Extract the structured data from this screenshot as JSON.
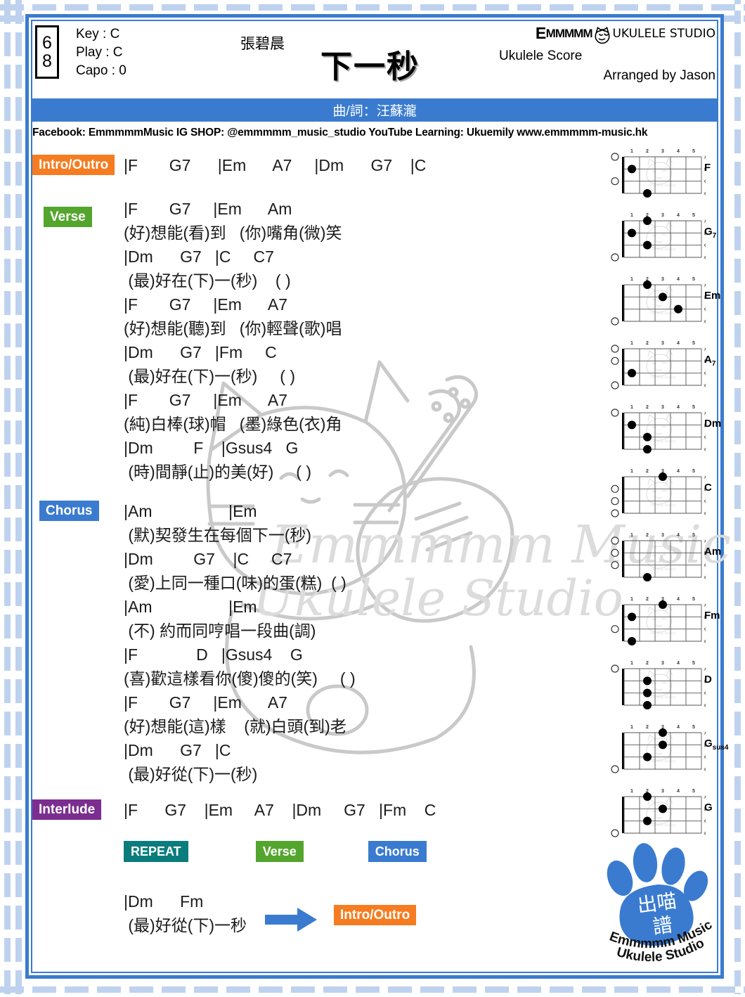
{
  "header": {
    "time_signature_top": "6",
    "time_signature_bottom": "8",
    "key_line": "Key : C",
    "play_line": "Play : C",
    "capo_line": "Capo : 0",
    "artist": "張碧晨",
    "song_title": "下一秒",
    "brand_em": "E",
    "brand_mmm": "MMMMM",
    "brand_studio": "UKULELE STUDIO",
    "brand_sub": "Ukulele Score",
    "arranged_by": "Arranged by Jason",
    "composer_bar": "曲/詞：汪蘇瀧"
  },
  "social": {
    "facebook_label": "Facebook:",
    "facebook_value": "EmmmmmMusic",
    "ig_label": "IG SHOP:",
    "ig_value": "@emmmmm_music_studio",
    "youtube_label": "YouTube Learning:",
    "youtube_value": "Ukuemily",
    "website": "www.emmmmm-music.hk"
  },
  "sections": [
    {
      "label": "Intro/Outro",
      "badge_color": "#F57C20",
      "lines": [
        {
          "type": "chord",
          "text": "|F       G7      |Em      A7     |Dm      G7    |C"
        }
      ]
    },
    {
      "label": "Verse",
      "badge_color": "#54A52D",
      "lines": [
        {
          "type": "chord",
          "text": "|F       G7     |Em      Am"
        },
        {
          "type": "lyric",
          "text": "(好)想能(看)到   (你)嘴角(微)笑"
        },
        {
          "type": "chord",
          "text": "|Dm      G7   |C     C7"
        },
        {
          "type": "lyric",
          "text": " (最)好在(下)一(秒)    ( )"
        },
        {
          "type": "chord",
          "text": "|F       G7     |Em      A7"
        },
        {
          "type": "lyric",
          "text": "(好)想能(聽)到   (你)輕聲(歌)唱"
        },
        {
          "type": "chord",
          "text": "|Dm      G7   |Fm     C"
        },
        {
          "type": "lyric",
          "text": " (最)好在(下)一(秒)     ( )"
        },
        {
          "type": "chord",
          "text": "|F       G7     |Em      A7"
        },
        {
          "type": "lyric",
          "text": "(純)白棒(球)帽   (墨)綠色(衣)角"
        },
        {
          "type": "chord",
          "text": "|Dm         F    |Gsus4   G"
        },
        {
          "type": "lyric",
          "text": " (時)間靜(止)的美(好)     ( )"
        }
      ]
    },
    {
      "label": "Chorus",
      "badge_color": "#3A7BD0",
      "lines": [
        {
          "type": "chord",
          "text": "|Am                 |Em"
        },
        {
          "type": "lyric",
          "text": " (默)契發生在每個下一(秒)"
        },
        {
          "type": "chord",
          "text": "|Dm         G7    |C     C7"
        },
        {
          "type": "lyric",
          "text": " (愛)上同一種口(味)的蛋(糕)  ( )"
        },
        {
          "type": "chord",
          "text": "|Am                 |Em"
        },
        {
          "type": "lyric",
          "text": " (不) 約而同哼唱一段曲(調)"
        },
        {
          "type": "chord",
          "text": "|F             D   |Gsus4    G"
        },
        {
          "type": "lyric",
          "text": "(喜)歡這樣看你(傻)傻的(笑)     ( )"
        },
        {
          "type": "chord",
          "text": "|F       G7     |Em      A7"
        },
        {
          "type": "lyric",
          "text": "(好)想能(這)樣    (就)白頭(到)老"
        },
        {
          "type": "chord",
          "text": "|Dm      G7   |C"
        },
        {
          "type": "lyric",
          "text": " (最)好從(下)一(秒)"
        }
      ]
    },
    {
      "label": "Interlude",
      "badge_color": "#7B2D90",
      "lines": [
        {
          "type": "chord",
          "text": "|F      G7    |Em     A7    |Dm     G7   |Fm    C"
        }
      ]
    }
  ],
  "flow": {
    "repeat_label": "REPEAT",
    "verse_label": "Verse",
    "chorus_label": "Chorus",
    "end_chord_line": "|Dm      Fm",
    "end_lyric_line": " (最)好從(下)一秒",
    "arrow_icon": "right-arrow-icon",
    "end_badge": "Intro/Outro"
  },
  "chords": [
    {
      "name": "F",
      "sub": "",
      "dots": [
        {
          "s": 1,
          "f": 1
        },
        {
          "s": 3,
          "f": 2
        }
      ],
      "open": [
        0,
        2
      ]
    },
    {
      "name": "G",
      "sub": "7",
      "dots": [
        {
          "s": 0,
          "f": 2
        },
        {
          "s": 1,
          "f": 1
        },
        {
          "s": 2,
          "f": 2
        }
      ],
      "open": [
        3
      ]
    },
    {
      "name": "Em",
      "sub": "",
      "dots": [
        {
          "s": 0,
          "f": 2
        },
        {
          "s": 1,
          "f": 3
        },
        {
          "s": 2,
          "f": 4
        }
      ],
      "open": [
        3
      ]
    },
    {
      "name": "A",
      "sub": "7",
      "dots": [
        {
          "s": 2,
          "f": 1
        }
      ],
      "open": [
        0,
        1,
        3
      ]
    },
    {
      "name": "Dm",
      "sub": "",
      "dots": [
        {
          "s": 1,
          "f": 1
        },
        {
          "s": 2,
          "f": 2
        },
        {
          "s": 3,
          "f": 2
        }
      ],
      "open": [
        0
      ]
    },
    {
      "name": "C",
      "sub": "",
      "dots": [
        {
          "s": 0,
          "f": 3
        }
      ],
      "open": [
        1,
        2,
        3
      ]
    },
    {
      "name": "Am",
      "sub": "",
      "dots": [
        {
          "s": 3,
          "f": 2
        }
      ],
      "open": [
        0,
        1,
        2
      ]
    },
    {
      "name": "Fm",
      "sub": "",
      "dots": [
        {
          "s": 0,
          "f": 3
        },
        {
          "s": 1,
          "f": 1
        },
        {
          "s": 3,
          "f": 1
        }
      ],
      "open": [
        2
      ]
    },
    {
      "name": "D",
      "sub": "",
      "dots": [
        {
          "s": 1,
          "f": 2
        },
        {
          "s": 2,
          "f": 2
        },
        {
          "s": 3,
          "f": 2
        }
      ],
      "open": [
        0
      ]
    },
    {
      "name": "G",
      "sub": "sus4",
      "dots": [
        {
          "s": 0,
          "f": 3
        },
        {
          "s": 1,
          "f": 3
        },
        {
          "s": 2,
          "f": 2
        }
      ],
      "open": [
        3
      ]
    },
    {
      "name": "G",
      "sub": "",
      "dots": [
        {
          "s": 0,
          "f": 2
        },
        {
          "s": 1,
          "f": 3
        },
        {
          "s": 2,
          "f": 2
        }
      ],
      "open": [
        3
      ]
    }
  ],
  "diagram_axes": {
    "fret_numbers": [
      "1",
      "2",
      "3",
      "4",
      "5"
    ],
    "string_names": [
      "A",
      "E",
      "C",
      "G"
    ]
  },
  "paw_logo": {
    "center_text": "出喵譜",
    "line1": "Emmmmm Music",
    "line2": "Ukulele Studio",
    "color": "#3A7BD0"
  },
  "colors": {
    "frame_blue": "#3A7BD0",
    "orange": "#F57C20",
    "green": "#54A52D",
    "purple": "#7B2D90",
    "teal": "#0A7C7C"
  }
}
